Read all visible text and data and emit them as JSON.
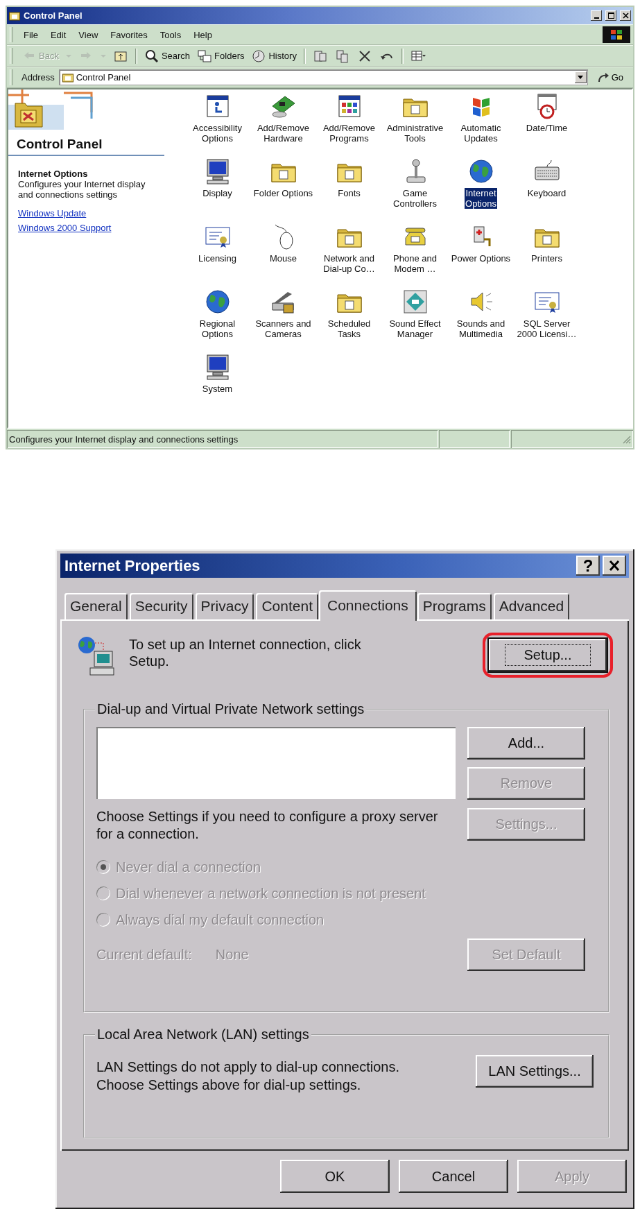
{
  "control_panel": {
    "window": {
      "title": "Control Panel"
    },
    "menu": [
      "File",
      "Edit",
      "View",
      "Favorites",
      "Tools",
      "Help"
    ],
    "toolbar_groups": [
      [
        {
          "kind": "back",
          "label": "Back",
          "disabled": true
        },
        {
          "kind": "dropdown",
          "disabled": true
        },
        {
          "kind": "forward",
          "disabled": true
        },
        {
          "kind": "dropdown",
          "disabled": true
        },
        {
          "kind": "up",
          "disabled": false
        }
      ],
      [
        {
          "kind": "search",
          "label": "Search",
          "disabled": false
        },
        {
          "kind": "folders",
          "label": "Folders",
          "disabled": false
        },
        {
          "kind": "history",
          "label": "History",
          "disabled": false
        }
      ],
      [
        {
          "kind": "move",
          "disabled": false
        },
        {
          "kind": "copy",
          "disabled": false
        },
        {
          "kind": "delete",
          "disabled": false
        },
        {
          "kind": "undo",
          "disabled": false
        }
      ],
      [
        {
          "kind": "views",
          "disabled": false
        }
      ]
    ],
    "address": {
      "label": "Address",
      "value": "Control Panel",
      "go": "Go"
    },
    "sidebar": {
      "heading": "Control Panel",
      "selected_title": "Internet Options",
      "description": "Configures your Internet display and connections settings",
      "links": [
        "Windows Update",
        "Windows 2000 Support"
      ]
    },
    "items": [
      {
        "label": "Accessibility\nOptions",
        "selected": false
      },
      {
        "label": "Add/Remove\nHardware",
        "selected": false
      },
      {
        "label": "Add/Remove\nPrograms",
        "selected": false
      },
      {
        "label": "Administrative\nTools",
        "selected": false
      },
      {
        "label": "Automatic\nUpdates",
        "selected": false
      },
      {
        "label": "Date/Time",
        "selected": false
      },
      {
        "label": "Display",
        "selected": false
      },
      {
        "label": "Folder Options",
        "selected": false
      },
      {
        "label": "Fonts",
        "selected": false
      },
      {
        "label": "Game\nControllers",
        "selected": false
      },
      {
        "label": "Internet\nOptions",
        "selected": true
      },
      {
        "label": "Keyboard",
        "selected": false
      },
      {
        "label": "Licensing",
        "selected": false
      },
      {
        "label": "Mouse",
        "selected": false
      },
      {
        "label": "Network and\nDial-up Co…",
        "selected": false
      },
      {
        "label": "Phone and\nModem …",
        "selected": false
      },
      {
        "label": "Power Options",
        "selected": false
      },
      {
        "label": "Printers",
        "selected": false
      },
      {
        "label": "Regional\nOptions",
        "selected": false
      },
      {
        "label": "Scanners and\nCameras",
        "selected": false
      },
      {
        "label": "Scheduled\nTasks",
        "selected": false
      },
      {
        "label": "Sound Effect\nManager",
        "selected": false
      },
      {
        "label": "Sounds and\nMultimedia",
        "selected": false
      },
      {
        "label": "SQL Server\n2000 Licensi…",
        "selected": false
      },
      {
        "label": "System",
        "selected": false
      }
    ],
    "status_bar": {
      "text": "Configures your Internet display and connections settings"
    }
  },
  "dialog": {
    "title": "Internet Properties",
    "help": "?",
    "tabs": [
      {
        "label": "General",
        "selected": false
      },
      {
        "label": "Security",
        "selected": false
      },
      {
        "label": "Privacy",
        "selected": false
      },
      {
        "label": "Content",
        "selected": false
      },
      {
        "label": "Connections",
        "selected": true
      },
      {
        "label": "Programs",
        "selected": false
      },
      {
        "label": "Advanced",
        "selected": false
      }
    ],
    "setup_text": "To set up an Internet connection, click Setup.",
    "setup_button": {
      "label": "Setup...",
      "focused": true,
      "highlighted": true
    },
    "dialup_group": {
      "legend": "Dial-up and Virtual Private Network settings",
      "buttons": [
        {
          "label": "Add...",
          "disabled": false
        },
        {
          "label": "Remove",
          "disabled": true
        },
        {
          "label": "Settings...",
          "disabled": true
        }
      ],
      "proxy_text": "Choose Settings if you need to configure a proxy server for a connection.",
      "options": [
        {
          "label": "Never dial a connection",
          "selected": true,
          "disabled": true
        },
        {
          "label": "Dial whenever a network connection is not present",
          "selected": false,
          "disabled": true
        },
        {
          "label": "Always dial my default connection",
          "selected": false,
          "disabled": true
        }
      ],
      "current_default": {
        "label": "Current default:",
        "value": "None",
        "disabled": true
      },
      "set_default": {
        "label": "Set Default",
        "disabled": true
      }
    },
    "lan_group": {
      "legend": "Local Area Network (LAN) settings",
      "lines": [
        "LAN Settings do not apply to dial-up connections.",
        "Choose Settings above for dial-up settings."
      ],
      "button": {
        "label": "LAN Settings...",
        "disabled": false
      }
    },
    "buttons": [
      {
        "label": "OK",
        "disabled": false
      },
      {
        "label": "Cancel",
        "disabled": false
      },
      {
        "label": "Apply",
        "disabled": true
      }
    ]
  }
}
